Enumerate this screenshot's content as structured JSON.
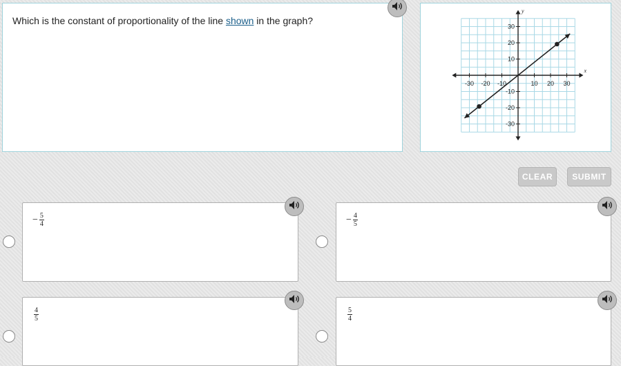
{
  "question": {
    "before": "Which is the constant of proportionality of the line ",
    "keyword": "shown",
    "after": " in the graph?"
  },
  "graph": {
    "x_ticks": [
      "-30",
      "-20",
      "-10",
      "10",
      "20",
      "30"
    ],
    "y_ticks": [
      "30",
      "20",
      "10",
      "-10",
      "-20",
      "-30"
    ],
    "x_axis_label": "x",
    "y_axis_label": "y",
    "line_start": [
      -33,
      -26.4
    ],
    "line_end": [
      32,
      25.6
    ],
    "points": [
      [
        -24,
        -19.2
      ],
      [
        24,
        19.2
      ]
    ]
  },
  "buttons": {
    "clear": "CLEAR",
    "submit": "SUBMIT"
  },
  "choices": [
    {
      "sign": "−",
      "num": "5",
      "den": "4"
    },
    {
      "sign": "−",
      "num": "4",
      "den": "5"
    },
    {
      "sign": "",
      "num": "4",
      "den": "5"
    },
    {
      "sign": "",
      "num": "5",
      "den": "4"
    }
  ],
  "colors": {
    "panel_border": "#9fd3dc",
    "grid": "#a9d8e6",
    "button": "#c9c9c9",
    "link": "#1a5e8a"
  }
}
